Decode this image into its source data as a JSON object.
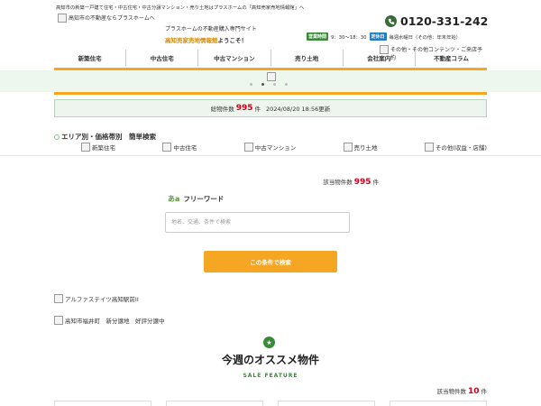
{
  "header": {
    "top_text": "高知市の新築一戸建て住宅・中古住宅・中古分譲マンション・売り土地はプラスホームの「高知売家売地情報館」へ",
    "logo_alt": "高知市の不動産ならプラスホームへ",
    "tagline": "プラスホームの不動産購入専門サイト",
    "welcome_brand": "高知売家売地情報館",
    "welcome_suffix": "ようこそ！",
    "phone": "0120-331-242",
    "hours_label": "営業時間",
    "hours": "9：30〜18：30",
    "holiday_label": "定休日",
    "holiday": "毎週水曜日（その他：年末年始）",
    "other_contents_alt": "その他・その他コンテンツ・ご来店予約"
  },
  "nav": {
    "items": [
      "新築住宅",
      "中古住宅",
      "中古マンション",
      "売り土地",
      "会社案内",
      "不動産コラム"
    ]
  },
  "count_bar": {
    "prefix": "総物件数",
    "count": "995",
    "suffix": "件",
    "updated": "2024/08/20 18:56更新"
  },
  "area_search": {
    "title": "エリア別・価格帯別　簡単検索",
    "categories": [
      "新築住宅",
      "中古住宅",
      "中古マンション",
      "売り土地",
      "その他(収益・店舗)"
    ]
  },
  "search": {
    "hits_label": "該当物件数",
    "hits_count": "995",
    "hits_suffix": "件",
    "freeword_icon": "あa",
    "freeword_label": "フリーワード",
    "placeholder": "地名、交通、条件で検索",
    "button": "この条件で検索"
  },
  "banners": [
    "アルファステイツ高知駅前II",
    "高知市福井町　新分譲地　好評分譲中"
  ],
  "feature": {
    "title": "今週のオススメ物件",
    "subtitle": "SALE FEATURE",
    "hits_label": "該当物件数",
    "hits_count": "10",
    "hits_suffix": "件"
  },
  "colors": {
    "accent": "#f5a623",
    "green": "#3a8a3a",
    "red": "#d0021b"
  }
}
